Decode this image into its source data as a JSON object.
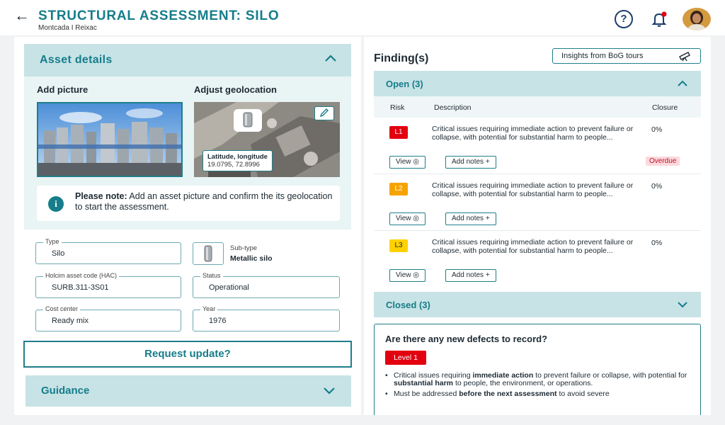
{
  "header": {
    "back_icon": "arrow-left-icon",
    "title": "STRUCTURAL ASSESSMENT: SILO",
    "subtitle": "Montcada I Reixac",
    "help_icon": "?"
  },
  "asset_details": {
    "title": "Asset details",
    "add_picture": "Add picture",
    "adjust_geolocation": "Adjust geolocation",
    "geo_label": "Latitude, longitude",
    "geo_value": "19.0795, 72.8996",
    "note_bold": "Please note:",
    "note_text": " Add an asset picture and confirm the its geolocation to start the assessment.",
    "fields": {
      "type_label": "Type",
      "type_value": "Silo",
      "subtype_label": "Sub-type",
      "subtype_value": "Metallic silo",
      "hac_label": "Holcim asset code (HAC)",
      "hac_value": "SURB.311-3S01",
      "status_label": "Status",
      "status_value": "Operational",
      "cost_label": "Cost center",
      "cost_value": "Ready mix",
      "year_label": "Year",
      "year_value": "1976"
    }
  },
  "request_update": "Request update?",
  "guidance": "Guidance",
  "findings": {
    "title": "Finding(s)",
    "insights": "Insights from BoG tours",
    "open_title": "Open (3)",
    "closed_title": "Closed (3)",
    "columns": {
      "risk": "Risk",
      "description": "Description",
      "closure": "Closure"
    },
    "items": [
      {
        "level": "L1",
        "description": "Critical issues requiring immediate action to prevent failure or collapse, with potential for substantial harm to people...",
        "closure": "0%",
        "view": "View",
        "add_notes": "Add notes +",
        "overdue": "Overdue"
      },
      {
        "level": "L2",
        "description": "Critical issues requiring immediate action to prevent failure or collapse, with potential for substantial harm to people...",
        "closure": "0%",
        "view": "View",
        "add_notes": "Add notes +"
      },
      {
        "level": "L3",
        "description": "Critical issues requiring immediate action to prevent failure or collapse, with potential for substantial harm to people...",
        "closure": "0%",
        "view": "View",
        "add_notes": "Add notes +"
      }
    ],
    "defects_question": "Are there any new defects to record?",
    "level1": "Level 1",
    "bullet1_a": "Critical issues requiring ",
    "bullet1_b": "immediate action",
    "bullet1_c": " to prevent failure or collapse, with potential for ",
    "bullet1_d": "substantial harm",
    "bullet1_e": " to people, the environment, or operations.",
    "bullet2_a": "Must be addressed ",
    "bullet2_b": "before the next assessment",
    "bullet2_c": " to avoid severe"
  },
  "colors": {
    "accent": "#167d8a",
    "panel": "#c7e3e6",
    "level1": "#e3000f",
    "level2": "#f6a300",
    "level3": "#ffd100"
  }
}
